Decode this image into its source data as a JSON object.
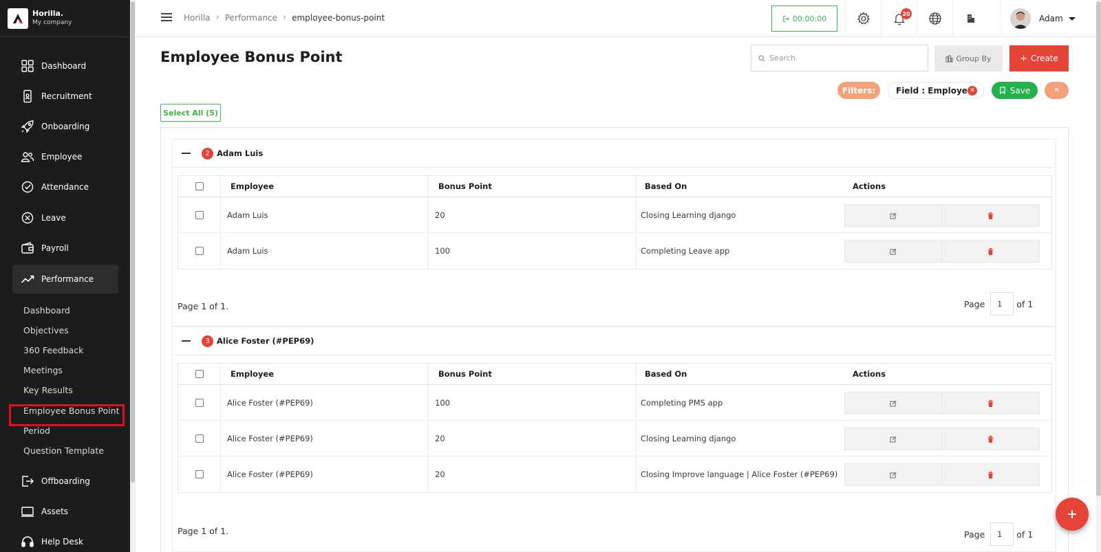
{
  "brand": {
    "name": "Horilla.",
    "company": "My company"
  },
  "sidebar": {
    "items": [
      {
        "label": "Dashboard",
        "icon": "grid-icon"
      },
      {
        "label": "Recruitment",
        "icon": "phone-user-icon"
      },
      {
        "label": "Onboarding",
        "icon": "rocket-icon"
      },
      {
        "label": "Employee",
        "icon": "people-icon"
      },
      {
        "label": "Attendance",
        "icon": "check-circle-icon"
      },
      {
        "label": "Leave",
        "icon": "x-circle-icon"
      },
      {
        "label": "Payroll",
        "icon": "wallet-icon"
      },
      {
        "label": "Performance",
        "icon": "trend-icon"
      },
      {
        "label": "Offboarding",
        "icon": "exit-icon"
      },
      {
        "label": "Assets",
        "icon": "laptop-icon"
      },
      {
        "label": "Help Desk",
        "icon": "headset-icon"
      }
    ],
    "performance_sub": [
      "Dashboard",
      "Objectives",
      "360 Feedback",
      "Meetings",
      "Key Results",
      "Employee Bonus Point",
      "Period",
      "Question Template"
    ]
  },
  "topbar": {
    "breadcrumb": [
      "Horilla",
      "Performance",
      "employee-bonus-point"
    ],
    "timer": "00:00:00",
    "notifications": "20",
    "user": "Adam"
  },
  "main": {
    "title": "Employee Bonus Point",
    "search_placeholder": "Search",
    "group_by": "Group By",
    "create": "Create",
    "filters_label": "Filters:",
    "filter_chip": "Field : Employee",
    "save": "Save",
    "select_all": "Select All (5)",
    "columns": [
      "Employee",
      "Bonus Point",
      "Based On",
      "Actions"
    ],
    "groups": [
      {
        "name": "Adam Luis",
        "count": "2",
        "rows": [
          {
            "employee": "Adam Luis",
            "bonus": "20",
            "based_on": "Closing Learning django"
          },
          {
            "employee": "Adam Luis",
            "bonus": "100",
            "based_on": "Completing Leave app"
          }
        ],
        "page_text": "Page 1 of 1.",
        "page_label": "Page",
        "page_value": "1",
        "page_of": "of 1"
      },
      {
        "name": "Alice Foster (#PEP69)",
        "count": "3",
        "rows": [
          {
            "employee": "Alice Foster (#PEP69)",
            "bonus": "100",
            "based_on": "Completing PMS app"
          },
          {
            "employee": "Alice Foster (#PEP69)",
            "bonus": "20",
            "based_on": "Closing Learning django"
          },
          {
            "employee": "Alice Foster (#PEP69)",
            "bonus": "20",
            "based_on": "Closing Improve language | Alice Foster (#PEP69)"
          }
        ],
        "page_text": "Page 1 of 1.",
        "page_label": "Page",
        "page_value": "1",
        "page_of": "of 1"
      }
    ]
  },
  "colors": {
    "accent": "#e54335",
    "green": "#3bb54a",
    "sidebar": "#1c1c1c",
    "filter": "#f5a27c"
  }
}
